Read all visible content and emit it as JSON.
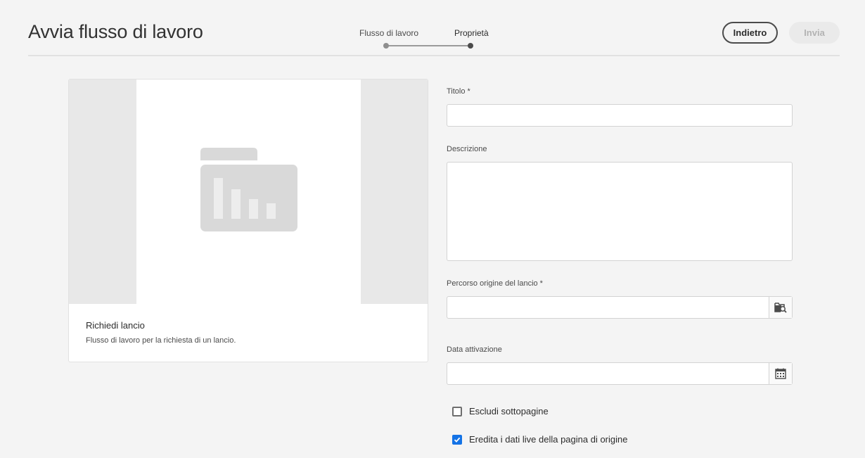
{
  "header": {
    "title": "Avvia flusso di lavoro",
    "steps": [
      {
        "label": "Flusso di lavoro"
      },
      {
        "label": "Proprietà"
      }
    ],
    "back_label": "Indietro",
    "submit_label": "Invia"
  },
  "card": {
    "title": "Richiedi lancio",
    "description": "Flusso di lavoro per la richiesta di un lancio.",
    "icon": "folder-chart-icon"
  },
  "form": {
    "title_label": "Titolo *",
    "title_value": "",
    "description_label": "Descrizione",
    "description_value": "",
    "source_path_label": "Percorso origine del lancio *",
    "source_path_value": "",
    "source_path_icon": "folder-search-icon",
    "activation_date_label": "Data attivazione",
    "activation_date_value": "",
    "activation_date_icon": "calendar-icon",
    "exclude_subpages_label": "Escludi sottopagine",
    "exclude_subpages_checked": false,
    "inherit_live_data_label": "Eredita i dati live della pagina di origine",
    "inherit_live_data_checked": true
  },
  "colors": {
    "accent": "#1473e6",
    "background": "#f4f4f4"
  }
}
